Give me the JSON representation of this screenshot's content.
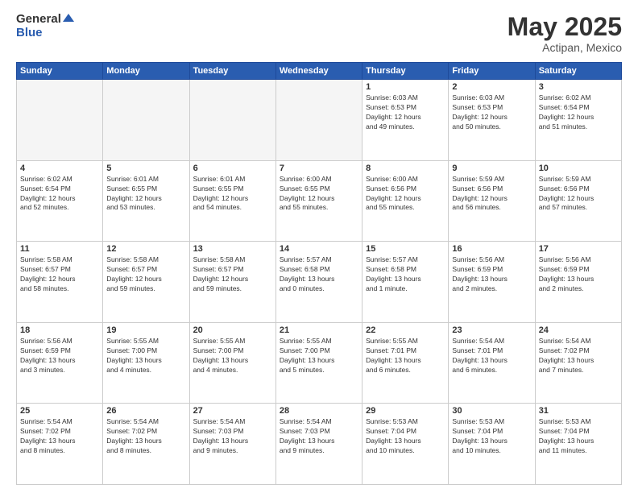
{
  "logo": {
    "general": "General",
    "blue": "Blue"
  },
  "title": "May 2025",
  "subtitle": "Actipan, Mexico",
  "weekdays": [
    "Sunday",
    "Monday",
    "Tuesday",
    "Wednesday",
    "Thursday",
    "Friday",
    "Saturday"
  ],
  "weeks": [
    [
      {
        "day": "",
        "info": "",
        "empty": true
      },
      {
        "day": "",
        "info": "",
        "empty": true
      },
      {
        "day": "",
        "info": "",
        "empty": true
      },
      {
        "day": "",
        "info": "",
        "empty": true
      },
      {
        "day": "1",
        "info": "Sunrise: 6:03 AM\nSunset: 6:53 PM\nDaylight: 12 hours\nand 49 minutes."
      },
      {
        "day": "2",
        "info": "Sunrise: 6:03 AM\nSunset: 6:53 PM\nDaylight: 12 hours\nand 50 minutes."
      },
      {
        "day": "3",
        "info": "Sunrise: 6:02 AM\nSunset: 6:54 PM\nDaylight: 12 hours\nand 51 minutes."
      }
    ],
    [
      {
        "day": "4",
        "info": "Sunrise: 6:02 AM\nSunset: 6:54 PM\nDaylight: 12 hours\nand 52 minutes."
      },
      {
        "day": "5",
        "info": "Sunrise: 6:01 AM\nSunset: 6:55 PM\nDaylight: 12 hours\nand 53 minutes."
      },
      {
        "day": "6",
        "info": "Sunrise: 6:01 AM\nSunset: 6:55 PM\nDaylight: 12 hours\nand 54 minutes."
      },
      {
        "day": "7",
        "info": "Sunrise: 6:00 AM\nSunset: 6:55 PM\nDaylight: 12 hours\nand 55 minutes."
      },
      {
        "day": "8",
        "info": "Sunrise: 6:00 AM\nSunset: 6:56 PM\nDaylight: 12 hours\nand 55 minutes."
      },
      {
        "day": "9",
        "info": "Sunrise: 5:59 AM\nSunset: 6:56 PM\nDaylight: 12 hours\nand 56 minutes."
      },
      {
        "day": "10",
        "info": "Sunrise: 5:59 AM\nSunset: 6:56 PM\nDaylight: 12 hours\nand 57 minutes."
      }
    ],
    [
      {
        "day": "11",
        "info": "Sunrise: 5:58 AM\nSunset: 6:57 PM\nDaylight: 12 hours\nand 58 minutes."
      },
      {
        "day": "12",
        "info": "Sunrise: 5:58 AM\nSunset: 6:57 PM\nDaylight: 12 hours\nand 59 minutes."
      },
      {
        "day": "13",
        "info": "Sunrise: 5:58 AM\nSunset: 6:57 PM\nDaylight: 12 hours\nand 59 minutes."
      },
      {
        "day": "14",
        "info": "Sunrise: 5:57 AM\nSunset: 6:58 PM\nDaylight: 13 hours\nand 0 minutes."
      },
      {
        "day": "15",
        "info": "Sunrise: 5:57 AM\nSunset: 6:58 PM\nDaylight: 13 hours\nand 1 minute."
      },
      {
        "day": "16",
        "info": "Sunrise: 5:56 AM\nSunset: 6:59 PM\nDaylight: 13 hours\nand 2 minutes."
      },
      {
        "day": "17",
        "info": "Sunrise: 5:56 AM\nSunset: 6:59 PM\nDaylight: 13 hours\nand 2 minutes."
      }
    ],
    [
      {
        "day": "18",
        "info": "Sunrise: 5:56 AM\nSunset: 6:59 PM\nDaylight: 13 hours\nand 3 minutes."
      },
      {
        "day": "19",
        "info": "Sunrise: 5:55 AM\nSunset: 7:00 PM\nDaylight: 13 hours\nand 4 minutes."
      },
      {
        "day": "20",
        "info": "Sunrise: 5:55 AM\nSunset: 7:00 PM\nDaylight: 13 hours\nand 4 minutes."
      },
      {
        "day": "21",
        "info": "Sunrise: 5:55 AM\nSunset: 7:00 PM\nDaylight: 13 hours\nand 5 minutes."
      },
      {
        "day": "22",
        "info": "Sunrise: 5:55 AM\nSunset: 7:01 PM\nDaylight: 13 hours\nand 6 minutes."
      },
      {
        "day": "23",
        "info": "Sunrise: 5:54 AM\nSunset: 7:01 PM\nDaylight: 13 hours\nand 6 minutes."
      },
      {
        "day": "24",
        "info": "Sunrise: 5:54 AM\nSunset: 7:02 PM\nDaylight: 13 hours\nand 7 minutes."
      }
    ],
    [
      {
        "day": "25",
        "info": "Sunrise: 5:54 AM\nSunset: 7:02 PM\nDaylight: 13 hours\nand 8 minutes."
      },
      {
        "day": "26",
        "info": "Sunrise: 5:54 AM\nSunset: 7:02 PM\nDaylight: 13 hours\nand 8 minutes."
      },
      {
        "day": "27",
        "info": "Sunrise: 5:54 AM\nSunset: 7:03 PM\nDaylight: 13 hours\nand 9 minutes."
      },
      {
        "day": "28",
        "info": "Sunrise: 5:54 AM\nSunset: 7:03 PM\nDaylight: 13 hours\nand 9 minutes."
      },
      {
        "day": "29",
        "info": "Sunrise: 5:53 AM\nSunset: 7:04 PM\nDaylight: 13 hours\nand 10 minutes."
      },
      {
        "day": "30",
        "info": "Sunrise: 5:53 AM\nSunset: 7:04 PM\nDaylight: 13 hours\nand 10 minutes."
      },
      {
        "day": "31",
        "info": "Sunrise: 5:53 AM\nSunset: 7:04 PM\nDaylight: 13 hours\nand 11 minutes."
      }
    ]
  ]
}
